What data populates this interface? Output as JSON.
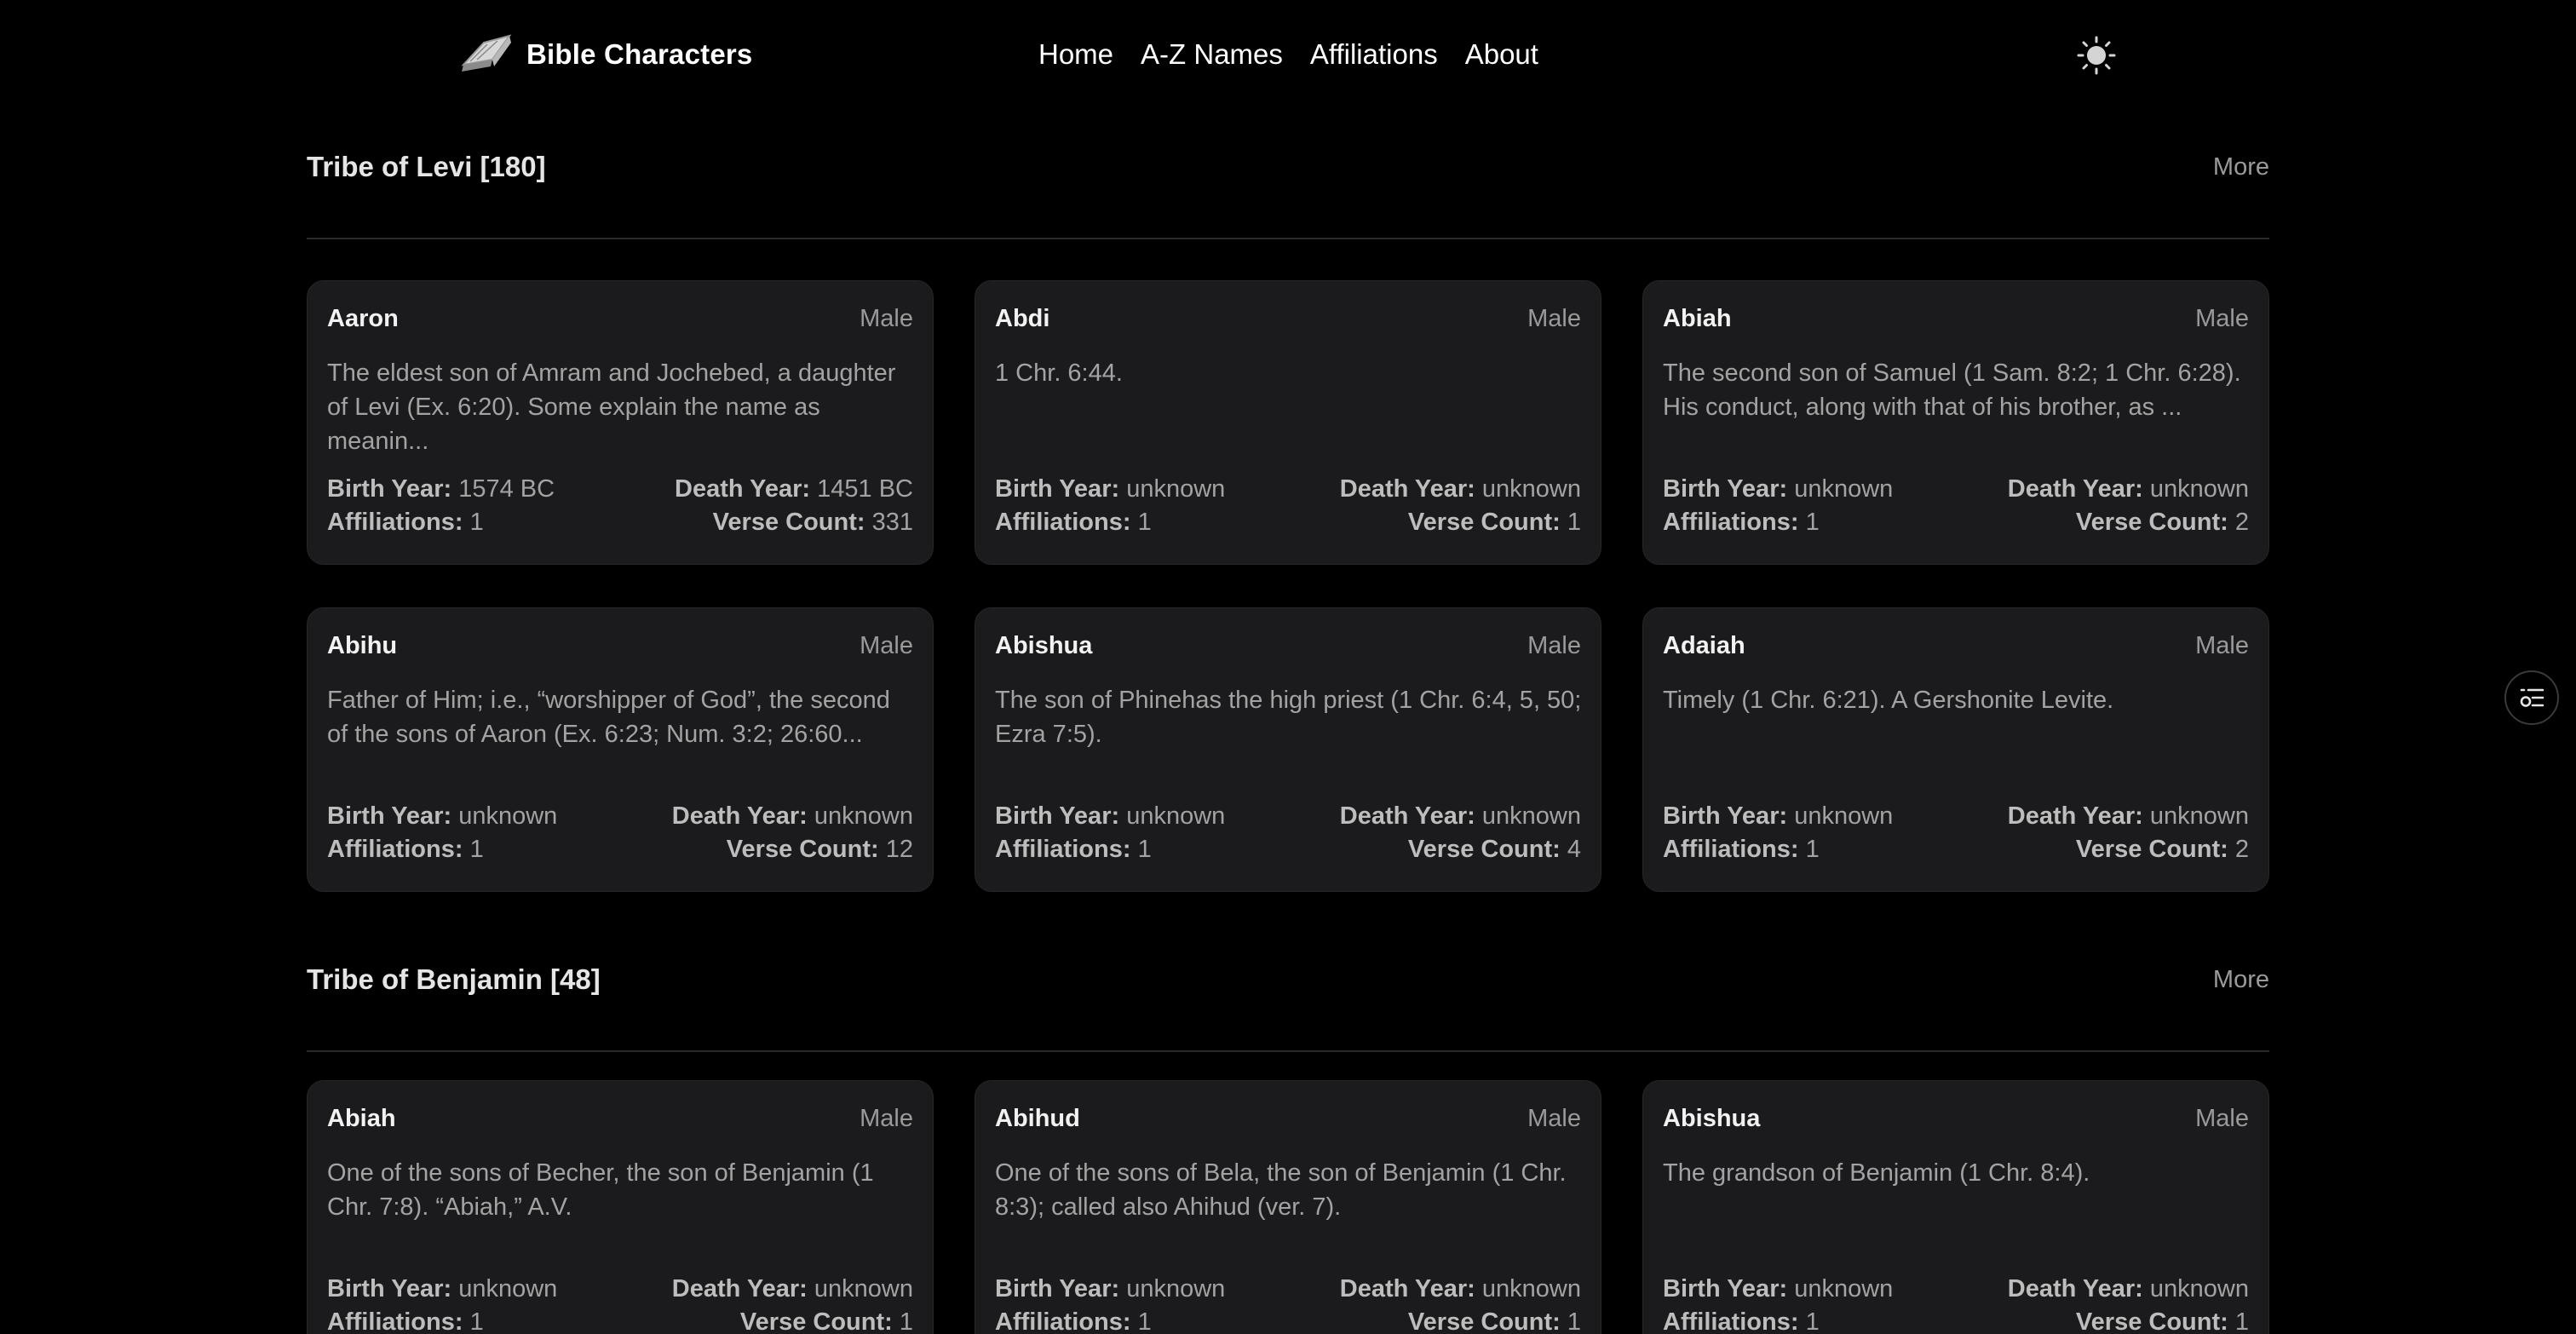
{
  "header": {
    "brand_name": "Bible Characters",
    "brand_icon": "open-bible-icon",
    "nav": [
      {
        "label": "Home"
      },
      {
        "label": "A-Z Names"
      },
      {
        "label": "Affiliations"
      },
      {
        "label": "About"
      }
    ],
    "theme_icon": "sun-icon"
  },
  "filter_icon": "filter-list-icon",
  "labels": {
    "birth": "Birth Year:",
    "death": "Death Year:",
    "affiliations": "Affiliations:",
    "verses": "Verse Count:"
  },
  "sections": [
    {
      "title": "Tribe of Levi [180]",
      "more": "More",
      "cards": [
        {
          "name": "Aaron",
          "gender": "Male",
          "desc": "The eldest son of Amram and Jochebed, a daughter of Levi (Ex. 6:20). Some explain the name as meanin...",
          "birth": "1574 BC",
          "death": "1451 BC",
          "affiliations": "1",
          "verses": "331"
        },
        {
          "name": "Abdi",
          "gender": "Male",
          "desc": "1 Chr. 6:44.",
          "birth": "unknown",
          "death": "unknown",
          "affiliations": "1",
          "verses": "1"
        },
        {
          "name": "Abiah",
          "gender": "Male",
          "desc": "The second son of Samuel (1 Sam. 8:2; 1 Chr. 6:28). His conduct, along with that of his brother, as ...",
          "birth": "unknown",
          "death": "unknown",
          "affiliations": "1",
          "verses": "2"
        },
        {
          "name": "Abihu",
          "gender": "Male",
          "desc": "Father of Him; i.e., “worshipper of God”, the second of the sons of Aaron (Ex. 6:23; Num. 3:2; 26:60...",
          "birth": "unknown",
          "death": "unknown",
          "affiliations": "1",
          "verses": "12"
        },
        {
          "name": "Abishua",
          "gender": "Male",
          "desc": "The son of Phinehas the high priest (1 Chr. 6:4, 5, 50; Ezra 7:5).",
          "birth": "unknown",
          "death": "unknown",
          "affiliations": "1",
          "verses": "4"
        },
        {
          "name": "Adaiah",
          "gender": "Male",
          "desc": "Timely (1 Chr. 6:21). A Gershonite Levite.",
          "birth": "unknown",
          "death": "unknown",
          "affiliations": "1",
          "verses": "2"
        }
      ]
    },
    {
      "title": "Tribe of Benjamin [48]",
      "more": "More",
      "cards": [
        {
          "name": "Abiah",
          "gender": "Male",
          "desc": "One of the sons of Becher, the son of Benjamin (1 Chr. 7:8). “Abiah,” A.V.",
          "birth": "unknown",
          "death": "unknown",
          "affiliations": "1",
          "verses": "1"
        },
        {
          "name": "Abihud",
          "gender": "Male",
          "desc": "One of the sons of Bela, the son of Benjamin (1 Chr. 8:3); called also Ahihud (ver. 7).",
          "birth": "unknown",
          "death": "unknown",
          "affiliations": "1",
          "verses": "1"
        },
        {
          "name": "Abishua",
          "gender": "Male",
          "desc": "The grandson of Benjamin (1 Chr. 8:4).",
          "birth": "unknown",
          "death": "unknown",
          "affiliations": "1",
          "verses": "1"
        }
      ]
    }
  ]
}
